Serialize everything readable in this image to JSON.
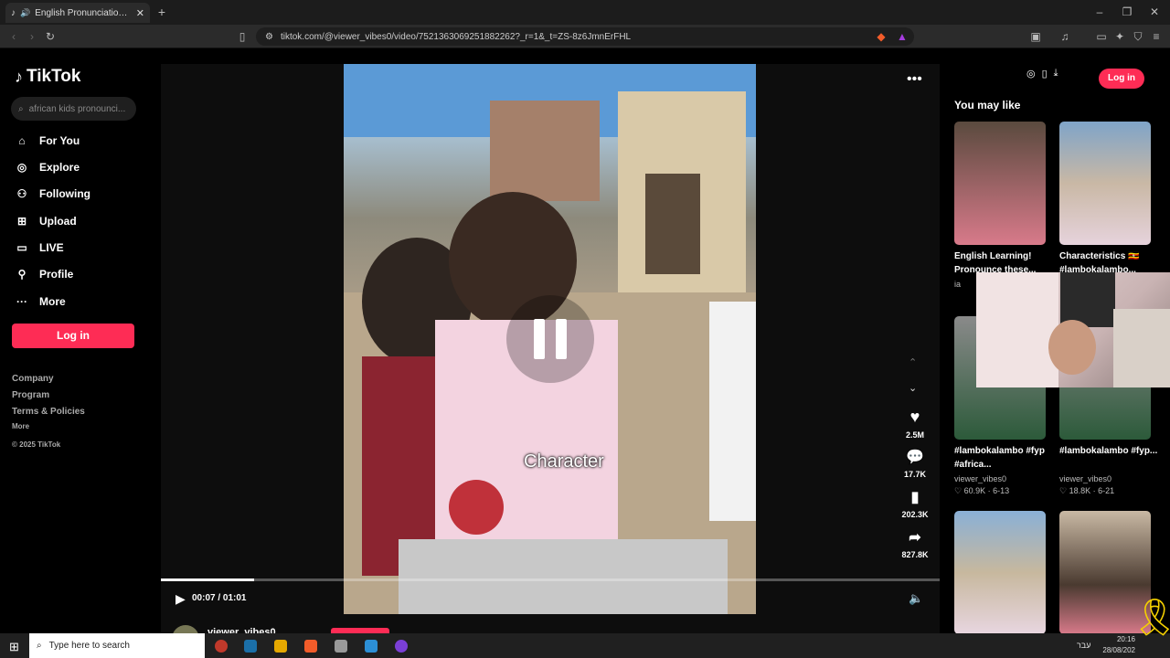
{
  "browser": {
    "tab_title": "English Pronunciation Tips wi",
    "new_tab": "+",
    "url": "tiktok.com/@viewer_vibes0/video/7521363069251882262?_r=1&_t=ZS-8z6JmnErFHL"
  },
  "sidebar": {
    "logo": "TikTok",
    "search_placeholder": "african kids pronounci...",
    "items": [
      {
        "label": "For You",
        "icon": "home-icon"
      },
      {
        "label": "Explore",
        "icon": "compass-icon"
      },
      {
        "label": "Following",
        "icon": "following-icon"
      },
      {
        "label": "Upload",
        "icon": "upload-icon"
      },
      {
        "label": "LIVE",
        "icon": "live-icon"
      },
      {
        "label": "Profile",
        "icon": "profile-icon"
      },
      {
        "label": "More",
        "icon": "more-icon"
      }
    ],
    "login": "Log in",
    "footer": {
      "company": "Company",
      "program": "Program",
      "terms": "Terms & Policies",
      "more": "More",
      "copyright": "© 2025 TikTok"
    }
  },
  "video": {
    "caption": "Character",
    "time": "00:07 / 01:01",
    "progress_fraction": 0.12,
    "likes": "2.5M",
    "comments": "17.7K",
    "saves": "202.3K",
    "shares": "827.8K",
    "author": "viewer_vibes0"
  },
  "header": {
    "login": "Log in"
  },
  "recommendations": {
    "heading": "You may like",
    "items": [
      {
        "title": "English Learning! Pronounce these...",
        "author": "ia",
        "stats": ""
      },
      {
        "title": "Characteristics 🇺🇬 #lambokalambo...",
        "author": "",
        "stats": ""
      },
      {
        "title": "#lambokalambo #fyp #africa...",
        "author": "viewer_vibes0",
        "stats": "60.9K · 6-13"
      },
      {
        "title": "#lambokalambo #fyp...",
        "author": "viewer_vibes0",
        "stats": "18.8K · 6-21"
      }
    ]
  },
  "taskbar": {
    "search_placeholder": "Type here to search",
    "time": "20:16",
    "date": "28/08/202",
    "lang": "עבר"
  },
  "colors": {
    "accent": "#fe2c55",
    "background": "#000000"
  }
}
